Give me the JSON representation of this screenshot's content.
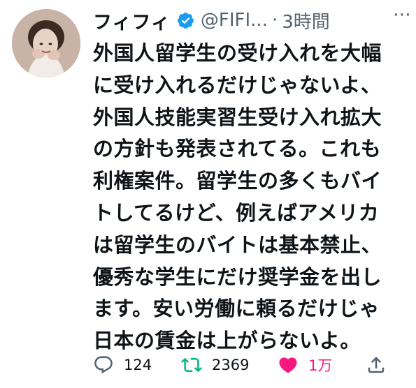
{
  "tweet": {
    "author_name": "フィフィ",
    "handle": "@FIFI...",
    "separator": "·",
    "time": "3時間",
    "more_label": "⋯",
    "text_lines": [
      "外国人留学生の受け入れを大幅",
      "に受け入れるだけじゃないよ、",
      "外国人技能実習生受け入れ拡大",
      "の方針も発表されてる。これも",
      "利権案件。留学生の多くもバイ",
      "トしてるけど、例えばアメリカ",
      "は留学生のバイトは基本禁止、",
      "優秀な学生にだけ奨学金を出し",
      "ます。安い労働に頼るだけじゃ",
      "日本の賃金は上がらないよ。"
    ],
    "stats": {
      "replies": "124",
      "retweets": "2369",
      "likes": "1万"
    },
    "icons": {
      "avatar": "profile-photo",
      "verified": "verified-badge-icon",
      "reply": "reply-icon",
      "retweet": "retweet-icon",
      "like": "heart-icon",
      "share": "share-icon"
    },
    "colors": {
      "text": "#0f1419",
      "secondary": "#536471",
      "verified": "#1d9bf0",
      "retweet": "#00ba7c",
      "like": "#f91880"
    }
  }
}
